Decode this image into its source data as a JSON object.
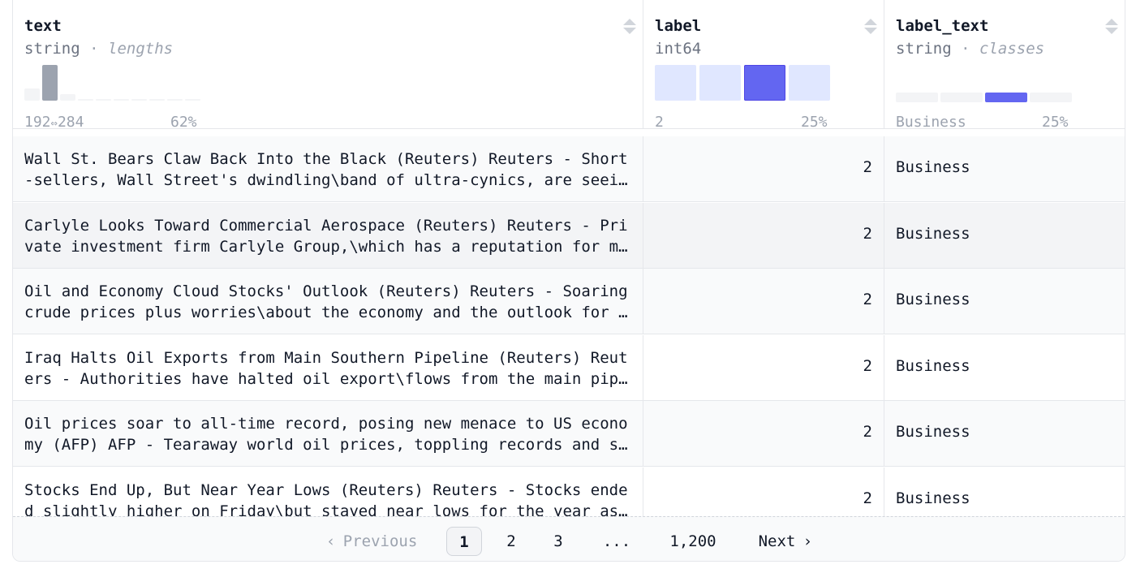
{
  "columns": [
    {
      "name": "text",
      "type": "string",
      "sub": "lengths",
      "hist_min": "192",
      "hist_arrow": "⇔",
      "hist_max": "284",
      "hist_pct": "62%",
      "bars": [
        0.35,
        1.0,
        0.18,
        0.05,
        0.05,
        0.05,
        0.05,
        0.05,
        0.05,
        0.05
      ],
      "highlight_bar": 1
    },
    {
      "name": "label",
      "type": "int64",
      "hist_left": "2",
      "hist_pct": "25%",
      "bars": [
        0.25,
        0.25,
        0.25,
        0.25
      ],
      "highlight_bar": 2
    },
    {
      "name": "label_text",
      "type": "string",
      "sub": "classes",
      "hist_left": "Business",
      "hist_pct": "25%",
      "segments": [
        0.25,
        0.25,
        0.25,
        0.25
      ],
      "highlight_segment": 2
    }
  ],
  "colors": {
    "accent": "#6366f1",
    "accent_light": "#e0e7ff",
    "bar_gray": "#9ca3af",
    "bar_light": "#f3f4f6"
  },
  "rows": [
    {
      "text": "Wall St. Bears Claw Back Into the Black (Reuters) Reuters - Short-sellers, Wall Street's dwindling\\band of ultra-cynics, are seeing green again.",
      "label": "2",
      "label_text": "Business"
    },
    {
      "text": "Carlyle Looks Toward Commercial Aerospace (Reuters) Reuters - Private investment firm Carlyle Group,\\which has a reputation for making well-timed and occasionally controversial plays.",
      "label": "2",
      "label_text": "Business"
    },
    {
      "text": "Oil and Economy Cloud Stocks' Outlook (Reuters) Reuters - Soaring crude prices plus worries\\about the economy and the outlook for earnings are expected to hang over the stock market.",
      "label": "2",
      "label_text": "Business"
    },
    {
      "text": "Iraq Halts Oil Exports from Main Southern Pipeline (Reuters) Reuters - Authorities have halted oil export\\flows from the main pipeline in southern Iraq.",
      "label": "2",
      "label_text": "Business"
    },
    {
      "text": "Oil prices soar to all-time record, posing new menace to US economy (AFP) AFP - Tearaway world oil prices, toppling records and straining wallets.",
      "label": "2",
      "label_text": "Business"
    },
    {
      "text": "Stocks End Up, But Near Year Lows (Reuters) Reuters - Stocks ended slightly higher on Friday\\but stayed near lows for the year as oil prices surged.",
      "label": "2",
      "label_text": "Business"
    }
  ],
  "pagination": {
    "previous": "Previous",
    "pages": [
      "1",
      "2",
      "3"
    ],
    "ellipsis": "...",
    "last": "1,200",
    "next": "Next",
    "current": "1"
  }
}
